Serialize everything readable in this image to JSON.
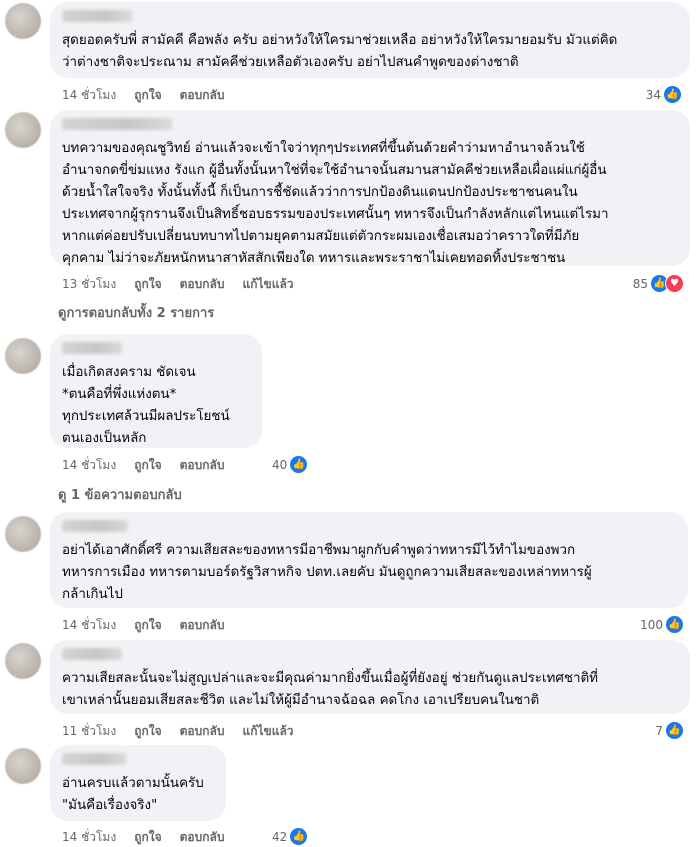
{
  "comments": [
    {
      "text": "สุดยอดครับพี่ สามัคคี คือพลัง ครับ อย่าหวังให้ใครมาช่วยเหลือ อย่าหวังให้ใครมายอมรับ มัวแต่คิด\nว่าต่างชาติจะประณาม สามัคคีช่วยเหลือตัวเองครับ อย่าไปสนคำพูดของต่างชาติ",
      "time": "14 ชั่วโมง",
      "like": "ถูกใจ",
      "reply": "ตอบกลับ",
      "reactions": "34"
    },
    {
      "text": "บทความของคุณชูวิทย์ อ่านแล้วจะเข้าใจว่าทุกๆประเทศที่ขึ้นต้นด้วยคำว่ามหาอำนาจล้วนใช้\nอำนาจกดขี่ข่มแหง รังแก ผู้อื่นทั้งนั้นหาใช่ที่จะใช้อำนาจนั้นสมานสามัคคีช่วยเหลือเผื่อแผ่แก่ผู้อื่น\nด้วยน้ำใสใจจริง ทั้งนั้นทั้งนี้ ก็เป็นการชี้ชัดแล้วว่าการปกป้องดินแดนปกป้องประชาชนคนใน\nประเทศจากผู้รุกรานจึงเป็นสิทธิ์ชอบธรรมของประเทศนั้นๆ ทหารจึงเป็นกำลังหลักแต่ไหนแต่ไรมา\nหากแต่ค่อยปรับเปลี่ยนบทบาทไปตามยุคตามสมัยแต่ตัวกระผมเองเชื่อเสมอว่าคราวใดที่มีภัย\nคุกคาม ไม่ว่าจะภัยหนักหนาสาหัสสักเพียงใด ทหารและพระราชาไม่เคยทอดทิ้งประชาชน",
      "time": "13 ชั่วโมง",
      "like": "ถูกใจ",
      "reply": "ตอบกลับ",
      "edited": "แก้ไขแล้ว",
      "reactions": "85"
    },
    {
      "text": "เมื่อเกิดสงคราม ชัดเจน\n*ตนคือที่พึ่งแห่งตน*\nทุกประเทศล้วนมีผลประโยชน์\nตนเองเป็นหลัก",
      "time": "14 ชั่วโมง",
      "like": "ถูกใจ",
      "reply": "ตอบกลับ",
      "reactions": "40"
    },
    {
      "text": "อย่าได้เอาศักดิ์ศรี ความเสียสละของทหารมีอาชีพมาผูกกับคำพูดว่าทหารมีไว้ทำไมของพวก\nทหารการเมือง ทหารตามบอร์ดรัฐวิสาหกิจ ปตท.เลยคับ มันดูถูกความเสียสละของเหล่าทหารผู้\nกล้าเกินไป",
      "time": "14 ชั่วโมง",
      "like": "ถูกใจ",
      "reply": "ตอบกลับ",
      "reactions": "100"
    },
    {
      "text": "ความเสียสละนั้นจะไม่สูญเปล่าและจะมีคุณค่ามากยิ่งขึ้นเมื่อผู้ที่ยังอยู่ ช่วยกันดูแลประเทศชาติที่\nเขาเหล่านั้นยอมเสียสละชีวิต และไม่ให้ผู้มีอำนาจฉ้อฉล คดโกง เอาเปรียบคนในชาติ",
      "time": "11 ชั่วโมง",
      "like": "ถูกใจ",
      "reply": "ตอบกลับ",
      "edited": "แก้ไขแล้ว",
      "reactions": "7"
    },
    {
      "text": "อ่านครบแล้วตามนั้นครับ\n\"มันคือเรื่องจริง\"",
      "time": "14 ชั่วโมง",
      "like": "ถูกใจ",
      "reply": "ตอบกลับ",
      "reactions": "42"
    }
  ],
  "view_replies_2": "ดูการตอบกลับทั้ง 2 รายการ",
  "view_replies_1": "ดู 1 ข้อความตอบกลับ",
  "icons": {
    "like": "thumbs-up-icon",
    "love": "heart-icon"
  },
  "colors": {
    "like": "#1877f2",
    "love": "#f33e58",
    "bubble": "#f0f2f5",
    "meta": "#65676b"
  }
}
